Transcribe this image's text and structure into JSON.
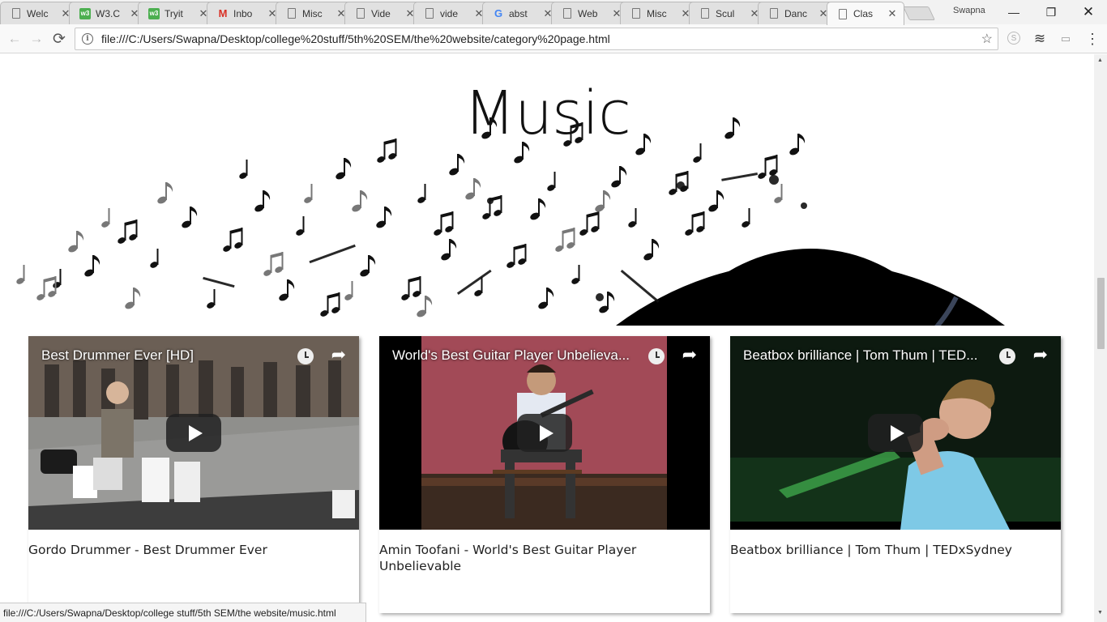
{
  "browser": {
    "tabs": [
      {
        "label": "Welc",
        "icon": "page-icon"
      },
      {
        "label": "W3.C",
        "icon": "w3schools-icon"
      },
      {
        "label": "Tryit",
        "icon": "w3schools-icon"
      },
      {
        "label": "Inbo",
        "icon": "gmail-icon"
      },
      {
        "label": "Misc",
        "icon": "page-icon"
      },
      {
        "label": "Vide",
        "icon": "page-icon"
      },
      {
        "label": "vide",
        "icon": "page-icon"
      },
      {
        "label": "abst",
        "icon": "google-icon"
      },
      {
        "label": "Web",
        "icon": "page-icon"
      },
      {
        "label": "Misc",
        "icon": "page-icon"
      },
      {
        "label": "Scul",
        "icon": "page-icon"
      },
      {
        "label": "Danc",
        "icon": "page-icon"
      },
      {
        "label": "Clas",
        "icon": "page-icon"
      }
    ],
    "profile_name": "Swapna",
    "address": "file:///C:/Users/Swapna/Desktop/college%20stuff/5th%20SEM/the%20website/category%20page.html",
    "status_url": "file:///C:/Users/Swapna/Desktop/college stuff/5th SEM/the website/music.html",
    "glyphs": {
      "back": "←",
      "forward": "→",
      "reload": "⟳",
      "star": "☆",
      "close": "✕",
      "minimize": "—",
      "restore": "❐",
      "window_close": "✕",
      "menu": "⋮",
      "info": "i",
      "share": "➦",
      "w3": "w3",
      "gmail": "M",
      "google": "G",
      "skype": "S",
      "layers": "≋",
      "cast": "▭",
      "scroll_up": "▲",
      "scroll_down": "▼"
    }
  },
  "page": {
    "heading": "Music",
    "videos": [
      {
        "video_title": "Best Drummer Ever [HD]",
        "caption": "Gordo Drummer - Best Drummer Ever"
      },
      {
        "video_title": "World's Best Guitar Player Unbelieva...",
        "caption": "Amin Toofani - World's Best Guitar Player Unbelievable"
      },
      {
        "video_title": "Beatbox brilliance | Tom Thum | TED...",
        "caption": "Beatbox brilliance | Tom Thum | TEDxSydney"
      }
    ]
  }
}
